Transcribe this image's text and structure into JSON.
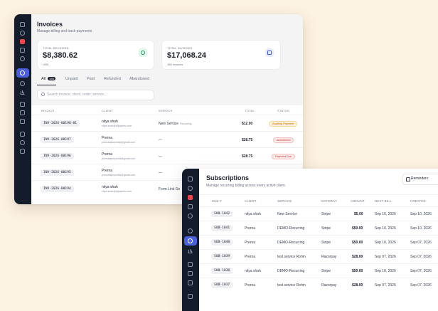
{
  "invoices": {
    "title": "Invoices",
    "subtitle": "Manage billing and track payments.",
    "cards": [
      {
        "label": "TOTAL RECEIVED",
        "value": "$8,380.62",
        "note": "USD",
        "icon": "wallet-icon",
        "icon_color": "#1f9d62",
        "icon_bg": "#e3f6ec"
      },
      {
        "label": "TOTAL INVOICES",
        "value": "$17,068.24",
        "note": "185 invoices",
        "icon": "document-icon",
        "icon_color": "#3d57d6",
        "icon_bg": "#e7ebfd"
      }
    ],
    "tabs": [
      {
        "label": "All",
        "count": "185"
      },
      {
        "label": "Unpaid"
      },
      {
        "label": "Paid"
      },
      {
        "label": "Refunded"
      },
      {
        "label": "Abandoned"
      }
    ],
    "search_placeholder": "Search invoice, client, order, service...",
    "columns": [
      "INVOICE",
      "CLIENT",
      "SERVICE",
      "TOTAL",
      "STATUS"
    ],
    "rows": [
      {
        "invoice": "INV-2026-00198-01",
        "client": "nitya shah",
        "email": "nitya.shah@alpcjents.com",
        "service": "New Service",
        "service_tag": "Recurring",
        "total": "$12.00",
        "status": "Awaiting Payment",
        "status_kind": "warn"
      },
      {
        "invoice": "INV-2026-00197",
        "client": "Prerna",
        "email": "prernalapurpedia@gmail.com",
        "service": "—",
        "service_tag": "",
        "total": "$28.75",
        "status": "Abandoned",
        "status_kind": "red"
      },
      {
        "invoice": "INV-2026-00196",
        "client": "Prerna",
        "email": "prernalapurpedia@gmail.com",
        "service": "—",
        "service_tag": "",
        "total": "$28.75",
        "status": "Payment Due",
        "status_kind": "red"
      },
      {
        "invoice": "INV-2026-00195",
        "client": "Prerna",
        "email": "prernalapurpedia@gmail.com",
        "service": "—",
        "service_tag": "",
        "total": "",
        "status": "",
        "status_kind": ""
      },
      {
        "invoice": "INV-2026-00194",
        "client": "nitya shah",
        "email": "nitya.shah@alpcjents.com",
        "service": "Form Link Ge",
        "service_tag": "",
        "total": "",
        "status": "",
        "status_kind": ""
      }
    ]
  },
  "subscriptions": {
    "title": "Subscriptions",
    "subtitle": "Manage recurring billing across every active client.",
    "reminders_label": "Reminders",
    "columns": [
      "SUB-#",
      "CLIENT",
      "SERVICE",
      "GATEWAY",
      "AMOUNT",
      "NEXT BILL",
      "CREATED"
    ],
    "rows": [
      {
        "sub": "SUB-1042",
        "client": "nitya shah",
        "service": "New Service",
        "gateway": "Stripe",
        "amount": "$5.00",
        "next": "Sep 16, 2026",
        "created": "Sep 10, 2026"
      },
      {
        "sub": "SUB-1041",
        "client": "Prerna",
        "service": "DEMO-Recurring",
        "gateway": "Stripe",
        "amount": "$50.00",
        "next": "Sep 10, 2026",
        "created": "Sep 10, 2026"
      },
      {
        "sub": "SUB-1040",
        "client": "Prerna",
        "service": "DEMO-Recurring",
        "gateway": "Stripe",
        "amount": "$50.00",
        "next": "Sep 10, 2026",
        "created": "Sep 07, 2026"
      },
      {
        "sub": "SUB-1039",
        "client": "Prerna",
        "service": "test service Rohin",
        "gateway": "Razorpay",
        "amount": "$28.00",
        "next": "Sep 07, 2026",
        "created": "Sep 07, 2026"
      },
      {
        "sub": "SUB-1038",
        "client": "nitya shah",
        "service": "DEMO-Recurring",
        "gateway": "Stripe",
        "amount": "$50.00",
        "next": "Sep 10, 2026",
        "created": "Sep 07, 2026"
      },
      {
        "sub": "SUB-1037",
        "client": "Prerna",
        "service": "test service Rohin",
        "gateway": "Razorpay",
        "amount": "$28.00",
        "next": "Sep 07, 2026",
        "created": "Sep 07, 2026"
      }
    ]
  }
}
